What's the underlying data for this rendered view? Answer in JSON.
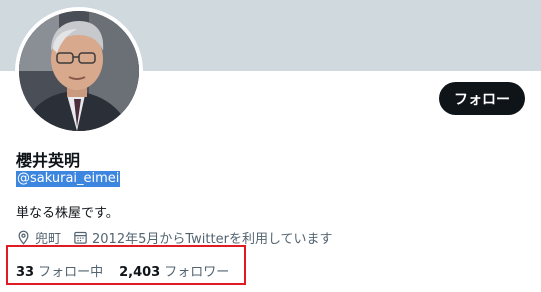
{
  "profile": {
    "name": "櫻井英明",
    "handle": "@sakurai_eimei",
    "bio": "単なる株屋です。",
    "location": "兜町",
    "joined": "2012年5月からTwitterを利用しています",
    "follow_button_label": "フォロー",
    "avatar_icon": "profile-photo",
    "location_icon": "location-pin-icon",
    "calendar_icon": "calendar-icon"
  },
  "stats": {
    "following_count": "33",
    "following_label": "フォロー中",
    "followers_count": "2,403",
    "followers_label": "フォロワー"
  },
  "colors": {
    "banner": "#cfd9de",
    "follow_button_bg": "#0f1419",
    "handle_highlight": "#3d86e0",
    "annotation_box": "#e01b24",
    "secondary_text": "#536471"
  }
}
